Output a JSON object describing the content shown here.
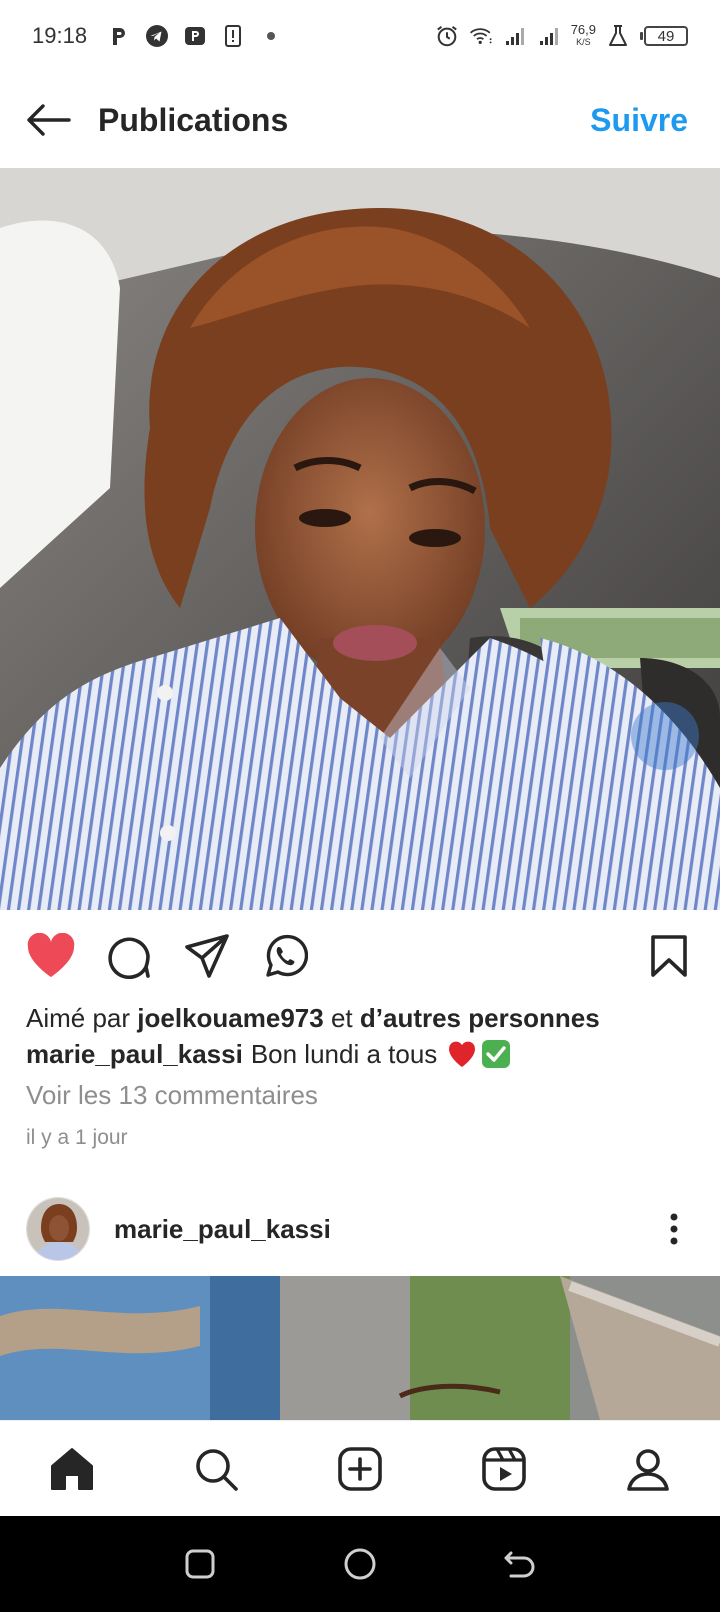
{
  "status_bar": {
    "time": "19:18",
    "net_speed_value": "76,9",
    "net_speed_unit": "K/S",
    "battery": "49",
    "left_icons": [
      "p-icon",
      "telegram-icon",
      "parking-app-icon",
      "alert-icon",
      "dot-icon"
    ],
    "right_icons": [
      "alarm-icon",
      "wifi-icon",
      "signal-icon",
      "signal-icon",
      "flask-icon",
      "battery-icon"
    ]
  },
  "header": {
    "title": "Publications",
    "follow_label": "Suivre"
  },
  "post": {
    "actions": [
      "heart-icon",
      "comment-icon",
      "share-icon",
      "whatsapp-icon",
      "bookmark-icon"
    ],
    "liked": true,
    "likes_prefix": "Aimé par",
    "likes_user": "joelkouame973",
    "likes_middle": "et",
    "likes_others": "d’autres personnes",
    "caption_user": "marie_paul_kassi",
    "caption_text": "Bon lundi a tous",
    "comments_link": "Voir les 13 commentaires",
    "time": "il y a 1 jour"
  },
  "next_post": {
    "username": "marie_paul_kassi"
  },
  "bottom_nav": {
    "items": [
      "home-icon",
      "search-icon",
      "create-icon",
      "reels-icon",
      "profile-icon"
    ]
  },
  "colors": {
    "accent": "#1b9af0",
    "like": "#ed4956",
    "text": "#262626",
    "muted": "#8e8e8e"
  }
}
